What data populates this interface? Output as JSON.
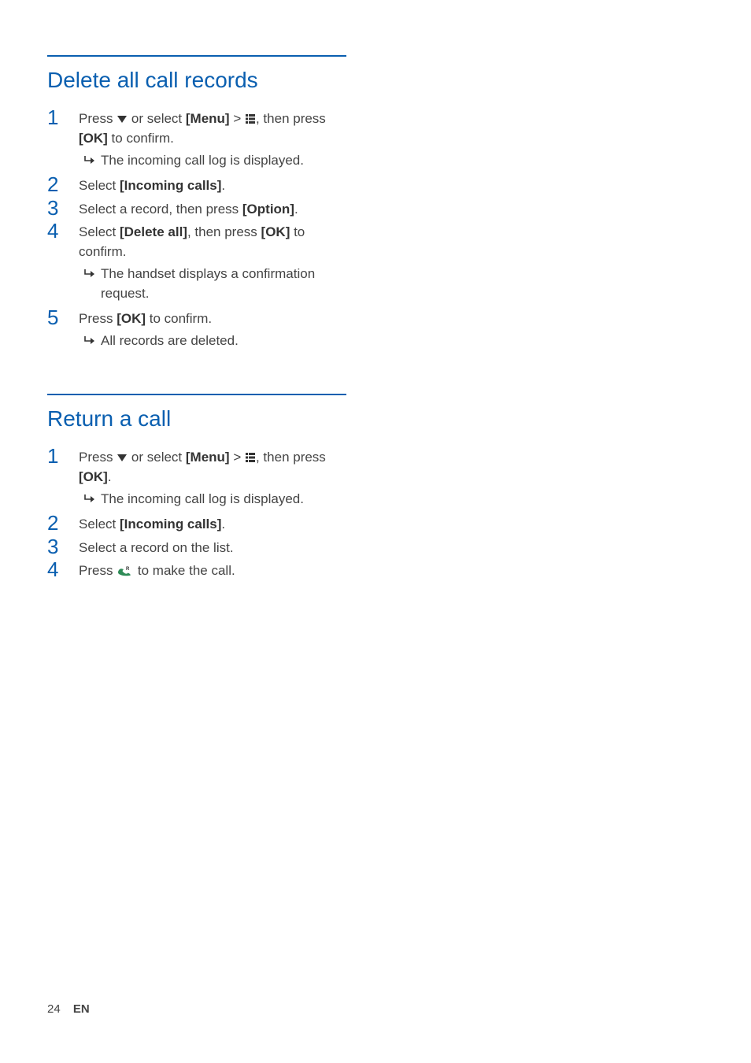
{
  "section1": {
    "heading": "Delete all call records",
    "steps": {
      "s1": {
        "num": "1",
        "txt1": "Press ",
        "txt2": " or select ",
        "menu": "[Menu]",
        "txt3": " > ",
        "txt4": ", then press ",
        "ok": "[OK]",
        "txt5": " to confirm.",
        "result": "The incoming call log is displayed."
      },
      "s2": {
        "num": "2",
        "txt1": "Select ",
        "bold1": "[Incoming calls]",
        "txt2": "."
      },
      "s3": {
        "num": "3",
        "txt1": "Select a record, then press ",
        "bold1": "[Option]",
        "txt2": "."
      },
      "s4": {
        "num": "4",
        "txt1": "Select ",
        "bold1": "[Delete all]",
        "txt2": ", then press ",
        "bold2": "[OK]",
        "txt3": " to confirm.",
        "result": "The handset displays a confirmation request."
      },
      "s5": {
        "num": "5",
        "txt1": "Press ",
        "bold1": "[OK]",
        "txt2": " to confirm.",
        "result": "All records are deleted."
      }
    }
  },
  "section2": {
    "heading": "Return a call",
    "steps": {
      "s1": {
        "num": "1",
        "txt1": "Press ",
        "txt2": " or select ",
        "menu": "[Menu]",
        "txt3": " > ",
        "txt4": ", then press ",
        "ok": "[OK]",
        "txt5": ".",
        "result": "The incoming call log is displayed."
      },
      "s2": {
        "num": "2",
        "txt1": "Select ",
        "bold1": "[Incoming calls]",
        "txt2": "."
      },
      "s3": {
        "num": "3",
        "txt1": "Select a record on the list."
      },
      "s4": {
        "num": "4",
        "txt1": "Press ",
        "txt2": " to make the call."
      }
    }
  },
  "footer": {
    "page": "24",
    "lang": "EN"
  }
}
